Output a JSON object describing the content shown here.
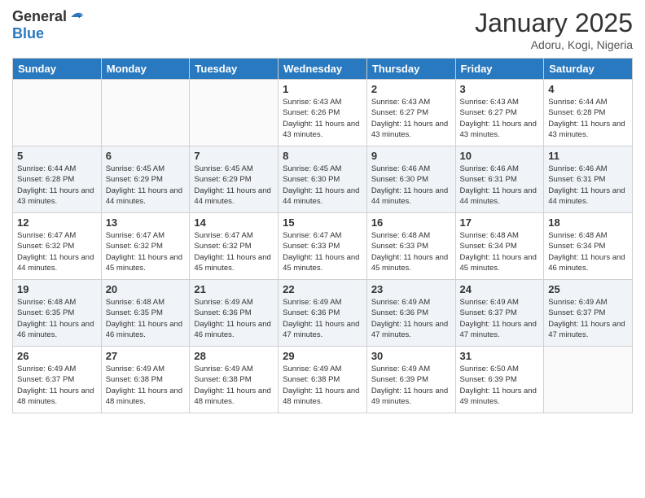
{
  "header": {
    "logo_general": "General",
    "logo_blue": "Blue",
    "month_title": "January 2025",
    "location": "Adoru, Kogi, Nigeria"
  },
  "weekdays": [
    "Sunday",
    "Monday",
    "Tuesday",
    "Wednesday",
    "Thursday",
    "Friday",
    "Saturday"
  ],
  "weeks": [
    [
      {
        "day": "",
        "sunrise": "",
        "sunset": "",
        "daylight": "",
        "empty": true
      },
      {
        "day": "",
        "sunrise": "",
        "sunset": "",
        "daylight": "",
        "empty": true
      },
      {
        "day": "",
        "sunrise": "",
        "sunset": "",
        "daylight": "",
        "empty": true
      },
      {
        "day": "1",
        "sunrise": "Sunrise: 6:43 AM",
        "sunset": "Sunset: 6:26 PM",
        "daylight": "Daylight: 11 hours and 43 minutes."
      },
      {
        "day": "2",
        "sunrise": "Sunrise: 6:43 AM",
        "sunset": "Sunset: 6:27 PM",
        "daylight": "Daylight: 11 hours and 43 minutes."
      },
      {
        "day": "3",
        "sunrise": "Sunrise: 6:43 AM",
        "sunset": "Sunset: 6:27 PM",
        "daylight": "Daylight: 11 hours and 43 minutes."
      },
      {
        "day": "4",
        "sunrise": "Sunrise: 6:44 AM",
        "sunset": "Sunset: 6:28 PM",
        "daylight": "Daylight: 11 hours and 43 minutes."
      }
    ],
    [
      {
        "day": "5",
        "sunrise": "Sunrise: 6:44 AM",
        "sunset": "Sunset: 6:28 PM",
        "daylight": "Daylight: 11 hours and 43 minutes."
      },
      {
        "day": "6",
        "sunrise": "Sunrise: 6:45 AM",
        "sunset": "Sunset: 6:29 PM",
        "daylight": "Daylight: 11 hours and 44 minutes."
      },
      {
        "day": "7",
        "sunrise": "Sunrise: 6:45 AM",
        "sunset": "Sunset: 6:29 PM",
        "daylight": "Daylight: 11 hours and 44 minutes."
      },
      {
        "day": "8",
        "sunrise": "Sunrise: 6:45 AM",
        "sunset": "Sunset: 6:30 PM",
        "daylight": "Daylight: 11 hours and 44 minutes."
      },
      {
        "day": "9",
        "sunrise": "Sunrise: 6:46 AM",
        "sunset": "Sunset: 6:30 PM",
        "daylight": "Daylight: 11 hours and 44 minutes."
      },
      {
        "day": "10",
        "sunrise": "Sunrise: 6:46 AM",
        "sunset": "Sunset: 6:31 PM",
        "daylight": "Daylight: 11 hours and 44 minutes."
      },
      {
        "day": "11",
        "sunrise": "Sunrise: 6:46 AM",
        "sunset": "Sunset: 6:31 PM",
        "daylight": "Daylight: 11 hours and 44 minutes."
      }
    ],
    [
      {
        "day": "12",
        "sunrise": "Sunrise: 6:47 AM",
        "sunset": "Sunset: 6:32 PM",
        "daylight": "Daylight: 11 hours and 44 minutes."
      },
      {
        "day": "13",
        "sunrise": "Sunrise: 6:47 AM",
        "sunset": "Sunset: 6:32 PM",
        "daylight": "Daylight: 11 hours and 45 minutes."
      },
      {
        "day": "14",
        "sunrise": "Sunrise: 6:47 AM",
        "sunset": "Sunset: 6:32 PM",
        "daylight": "Daylight: 11 hours and 45 minutes."
      },
      {
        "day": "15",
        "sunrise": "Sunrise: 6:47 AM",
        "sunset": "Sunset: 6:33 PM",
        "daylight": "Daylight: 11 hours and 45 minutes."
      },
      {
        "day": "16",
        "sunrise": "Sunrise: 6:48 AM",
        "sunset": "Sunset: 6:33 PM",
        "daylight": "Daylight: 11 hours and 45 minutes."
      },
      {
        "day": "17",
        "sunrise": "Sunrise: 6:48 AM",
        "sunset": "Sunset: 6:34 PM",
        "daylight": "Daylight: 11 hours and 45 minutes."
      },
      {
        "day": "18",
        "sunrise": "Sunrise: 6:48 AM",
        "sunset": "Sunset: 6:34 PM",
        "daylight": "Daylight: 11 hours and 46 minutes."
      }
    ],
    [
      {
        "day": "19",
        "sunrise": "Sunrise: 6:48 AM",
        "sunset": "Sunset: 6:35 PM",
        "daylight": "Daylight: 11 hours and 46 minutes."
      },
      {
        "day": "20",
        "sunrise": "Sunrise: 6:48 AM",
        "sunset": "Sunset: 6:35 PM",
        "daylight": "Daylight: 11 hours and 46 minutes."
      },
      {
        "day": "21",
        "sunrise": "Sunrise: 6:49 AM",
        "sunset": "Sunset: 6:36 PM",
        "daylight": "Daylight: 11 hours and 46 minutes."
      },
      {
        "day": "22",
        "sunrise": "Sunrise: 6:49 AM",
        "sunset": "Sunset: 6:36 PM",
        "daylight": "Daylight: 11 hours and 47 minutes."
      },
      {
        "day": "23",
        "sunrise": "Sunrise: 6:49 AM",
        "sunset": "Sunset: 6:36 PM",
        "daylight": "Daylight: 11 hours and 47 minutes."
      },
      {
        "day": "24",
        "sunrise": "Sunrise: 6:49 AM",
        "sunset": "Sunset: 6:37 PM",
        "daylight": "Daylight: 11 hours and 47 minutes."
      },
      {
        "day": "25",
        "sunrise": "Sunrise: 6:49 AM",
        "sunset": "Sunset: 6:37 PM",
        "daylight": "Daylight: 11 hours and 47 minutes."
      }
    ],
    [
      {
        "day": "26",
        "sunrise": "Sunrise: 6:49 AM",
        "sunset": "Sunset: 6:37 PM",
        "daylight": "Daylight: 11 hours and 48 minutes."
      },
      {
        "day": "27",
        "sunrise": "Sunrise: 6:49 AM",
        "sunset": "Sunset: 6:38 PM",
        "daylight": "Daylight: 11 hours and 48 minutes."
      },
      {
        "day": "28",
        "sunrise": "Sunrise: 6:49 AM",
        "sunset": "Sunset: 6:38 PM",
        "daylight": "Daylight: 11 hours and 48 minutes."
      },
      {
        "day": "29",
        "sunrise": "Sunrise: 6:49 AM",
        "sunset": "Sunset: 6:38 PM",
        "daylight": "Daylight: 11 hours and 48 minutes."
      },
      {
        "day": "30",
        "sunrise": "Sunrise: 6:49 AM",
        "sunset": "Sunset: 6:39 PM",
        "daylight": "Daylight: 11 hours and 49 minutes."
      },
      {
        "day": "31",
        "sunrise": "Sunrise: 6:50 AM",
        "sunset": "Sunset: 6:39 PM",
        "daylight": "Daylight: 11 hours and 49 minutes."
      },
      {
        "day": "",
        "sunrise": "",
        "sunset": "",
        "daylight": "",
        "empty": true
      }
    ]
  ]
}
